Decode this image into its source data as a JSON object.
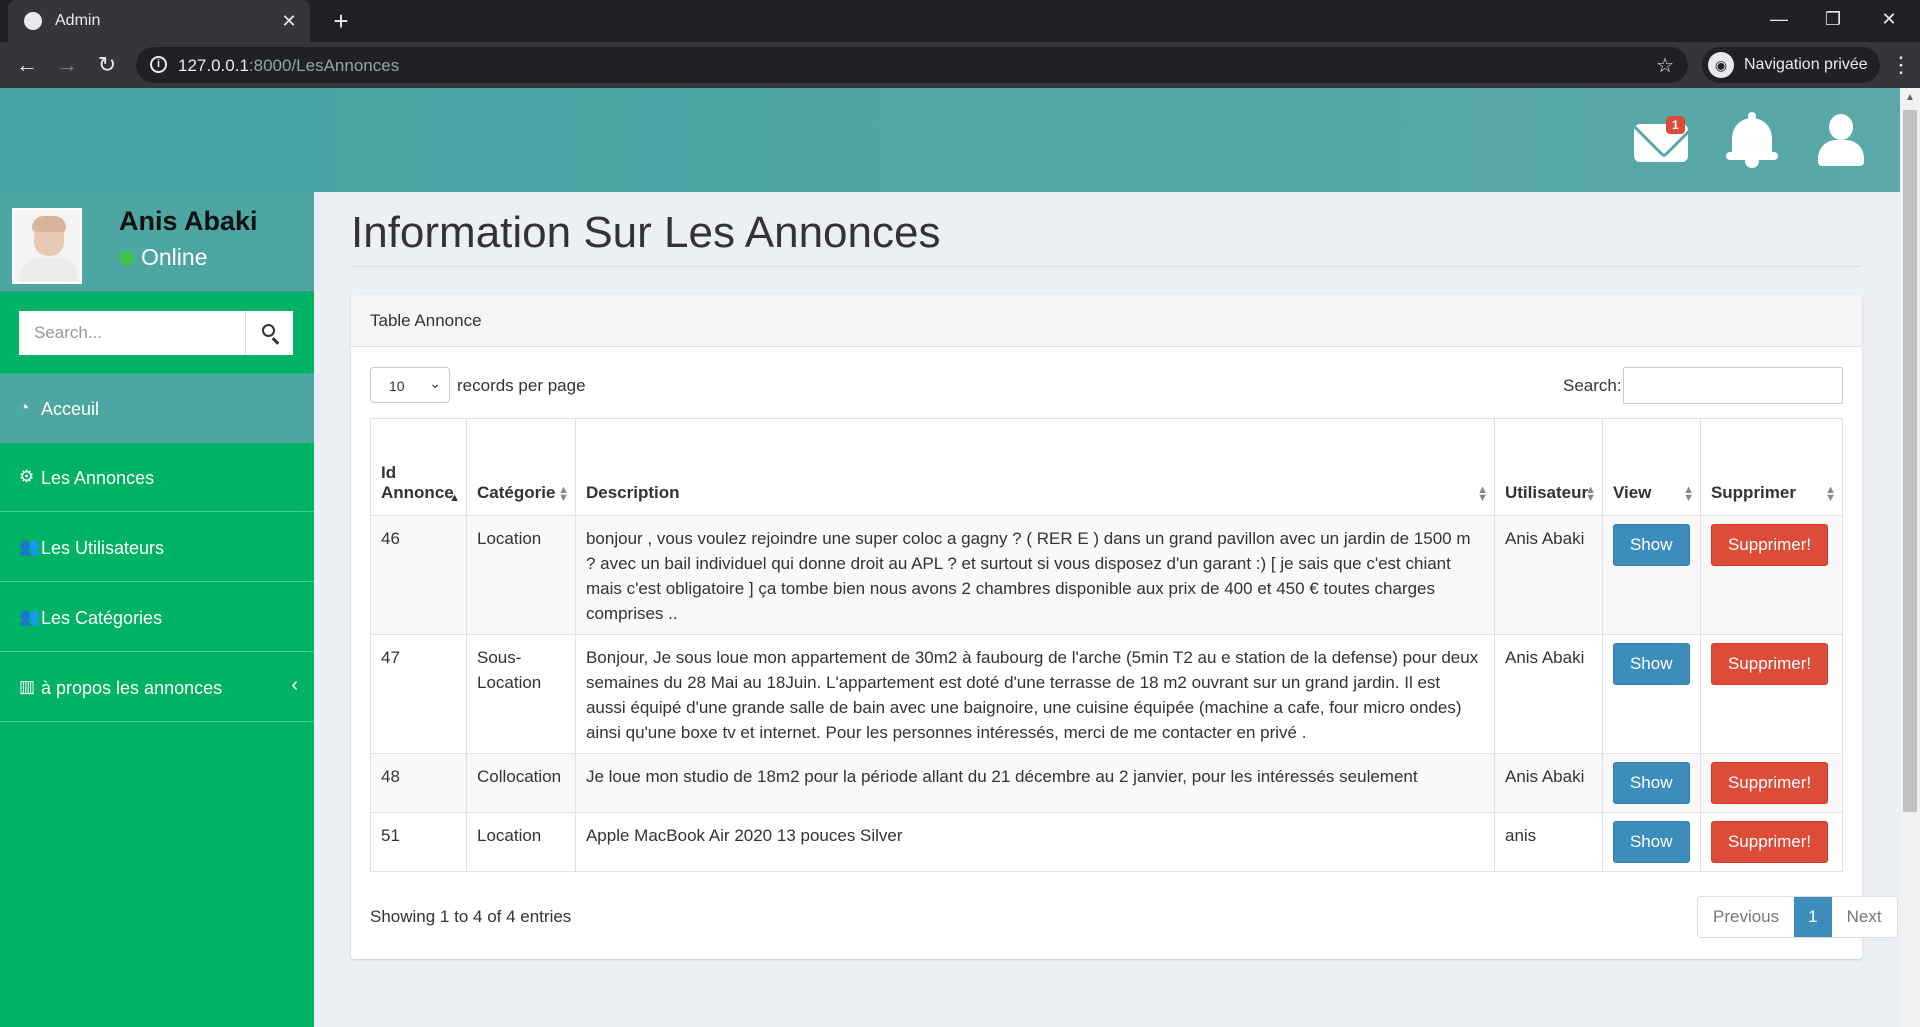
{
  "browser": {
    "tab_title": "Admin",
    "tab_close": "✕",
    "new_tab": "+",
    "url_host": "127.0.0.1",
    "url_path": ":8000/LesAnnonces",
    "incognito_label": "Navigation privée",
    "icons": [
      "back-icon",
      "forward-icon",
      "reload-icon",
      "info-icon",
      "star-icon",
      "incognito-icon",
      "menu-icon"
    ]
  },
  "header": {
    "mail_badge": "1",
    "icons": [
      "envelope-icon",
      "bell-icon",
      "user-icon"
    ],
    "color": "#4ea6a3"
  },
  "sidebar": {
    "user_name": "Anis Abaki",
    "user_status": "Online",
    "search_placeholder": "Search...",
    "items": [
      {
        "label": "Acceuil",
        "icon": "dashboard-icon"
      },
      {
        "label": "Les Annonces",
        "icon": "cogs-icon"
      },
      {
        "label": "Les Utilisateurs",
        "icon": "users-icon"
      },
      {
        "label": "Les Catégories",
        "icon": "users-icon"
      },
      {
        "label": "à propos les annonces",
        "icon": "bar-chart-icon"
      }
    ],
    "color": "#00b263"
  },
  "main": {
    "page_title": "Information Sur Les Annonces",
    "box_title": "Table Annonce",
    "length_value": "10",
    "length_label": "records per page",
    "search_label": "Search:",
    "columns": [
      "Id Annonce",
      "Catégorie",
      "Description",
      "Utilisateur",
      "View",
      "Supprimer"
    ],
    "rows": [
      {
        "id": "46",
        "categorie": "Location",
        "description": "bonjour , vous voulez rejoindre une super coloc a gagny ? ( RER E ) dans un grand pavillon avec un jardin de 1500 m ? avec un bail individuel qui donne droit au APL ? et surtout si vous disposez d'un garant :) [ je sais que c'est chiant mais c'est obligatoire ] ça tombe bien nous avons 2 chambres disponible aux prix de 400 et 450 € toutes charges comprises ..",
        "utilisateur": "Anis Abaki",
        "show": "Show",
        "delete": "Supprimer!"
      },
      {
        "id": "47",
        "categorie": "Sous-Location",
        "description": "Bonjour, Je sous loue mon appartement de 30m2 à faubourg de l'arche (5min T2 au e station de la defense) pour deux semaines du 28 Mai au 18Juin. L'appartement est doté d'une terrasse de 18 m2 ouvrant sur un grand jardin. Il est aussi équipé d'une grande salle de bain avec une baignoire, une cuisine équipée (machine a cafe, four micro ondes) ainsi qu'une boxe tv et internet. Pour les personnes intéressés, merci de me contacter en privé .",
        "utilisateur": "Anis Abaki",
        "show": "Show",
        "delete": "Supprimer!"
      },
      {
        "id": "48",
        "categorie": "Collocation",
        "description": "Je loue mon studio de 18m2 pour la période allant du 21 décembre au 2 janvier, pour les intéressés seulement",
        "utilisateur": "Anis Abaki",
        "show": "Show",
        "delete": "Supprimer!"
      },
      {
        "id": "51",
        "categorie": "Location",
        "description": "Apple MacBook Air 2020 13 pouces Silver",
        "utilisateur": "anis",
        "show": "Show",
        "delete": "Supprimer!"
      }
    ],
    "info": "Showing 1 to 4 of 4 entries",
    "pagination": {
      "previous": "Previous",
      "current": "1",
      "next": "Next"
    },
    "colors": {
      "show": "#3c8dbc",
      "delete": "#dd4b39"
    }
  }
}
